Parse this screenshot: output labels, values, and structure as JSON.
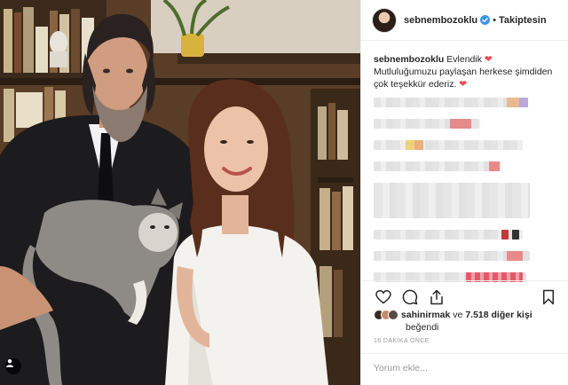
{
  "post": {
    "username": "sebnembozoklu",
    "follow_label": "Takiptesin",
    "caption_user": "sebnembozoklu",
    "caption_line1": "Evlendik",
    "caption_line2": "Mutluluğumuzu paylaşan herkese şimdiden",
    "caption_line3": "çok teşekkür ederiz.",
    "likes_user": "sahinirmak",
    "likes_connector": "ve",
    "likes_count": "7.518 diğer kişi",
    "liked_label": "beğendi",
    "time": "16 DAKİKA ÖNCE",
    "comment_placeholder": "Yorum ekle..."
  },
  "icons": {
    "verified": "verified-badge-icon",
    "like": "heart-outline-icon",
    "comment": "comment-bubble-icon",
    "share": "share-icon",
    "save": "bookmark-icon",
    "user_tag": "user-tag-icon"
  },
  "colors": {
    "verified_blue": "#3897f0",
    "heart_red": "#ed4956",
    "text": "#262626",
    "muted": "#999999",
    "border": "#efefef"
  }
}
